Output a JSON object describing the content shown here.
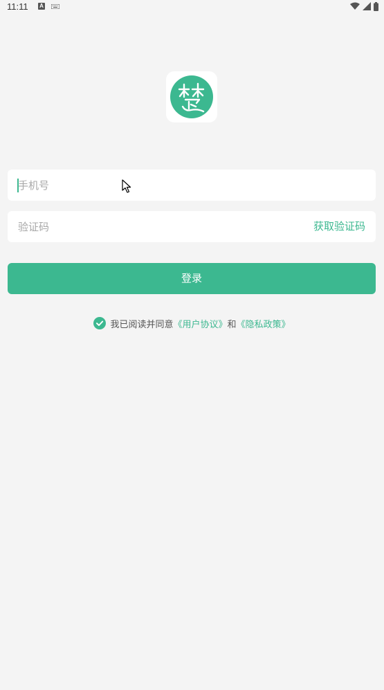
{
  "status_bar": {
    "time": "11:11",
    "a_icon_letter": "A"
  },
  "logo": {
    "name": "chu-logo-icon",
    "brand_color": "#3cb890"
  },
  "phone_field": {
    "placeholder": "手机号",
    "value": ""
  },
  "code_field": {
    "placeholder": "验证码",
    "value": "",
    "get_code_label": "获取验证码"
  },
  "login_button": {
    "label": "登录"
  },
  "agreement": {
    "checked": true,
    "prefix": "我已阅读并同意",
    "user_agreement": "《用户协议》",
    "conjunction": "和",
    "privacy_policy": "《隐私政策》"
  },
  "colors": {
    "accent": "#3cb890",
    "background": "#f4f4f4",
    "field_background": "#ffffff",
    "placeholder": "#a8a8a8"
  }
}
